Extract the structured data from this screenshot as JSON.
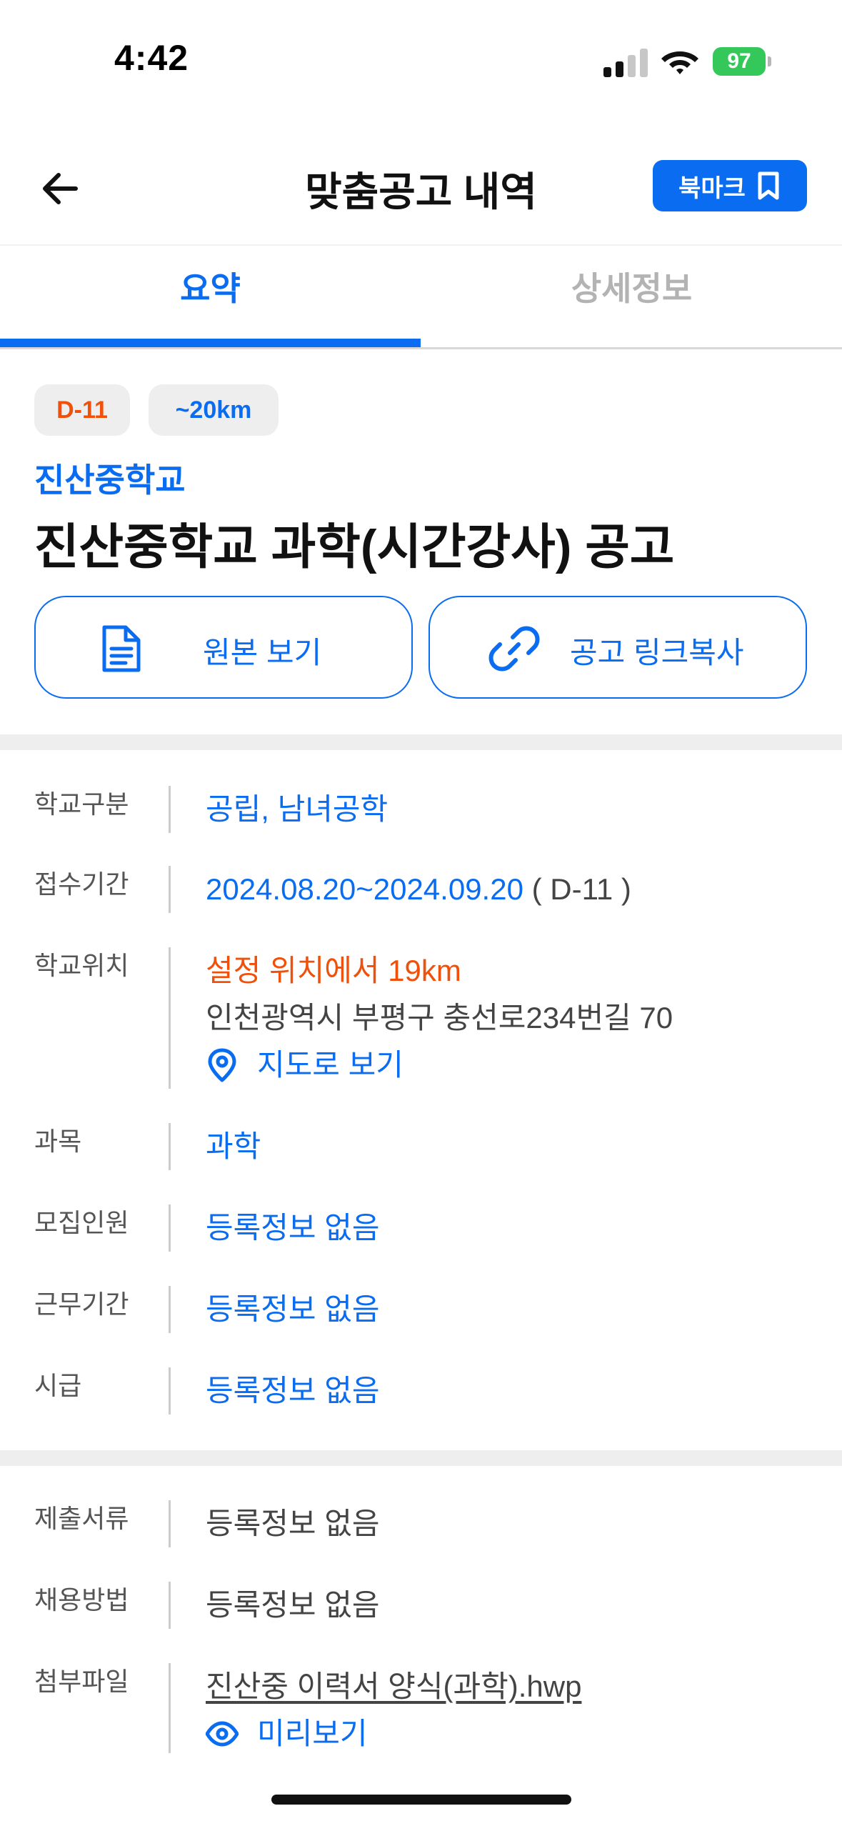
{
  "status_bar": {
    "time": "4:42",
    "battery": "97"
  },
  "header": {
    "title": "맞춤공고 내역",
    "bookmark_label": "북마크"
  },
  "tabs": [
    {
      "label": "요약",
      "active": true
    },
    {
      "label": "상세정보",
      "active": false
    }
  ],
  "badges": {
    "dday": "D-11",
    "distance": "~20km"
  },
  "school": {
    "name": "진산중학교",
    "title": "진산중학교 과학(시간강사) 공고"
  },
  "actions": {
    "view_original": "원본 보기",
    "copy_link": "공고 링크복사"
  },
  "info": {
    "school_type": {
      "label": "학교구분",
      "value": "공립, 남녀공학"
    },
    "period": {
      "label": "접수기간",
      "value": "2024.08.20~2024.09.20",
      "suffix": " ( D-11 )"
    },
    "location": {
      "label": "학교위치",
      "distance": "설정 위치에서 19km",
      "address": "인천광역시 부평구 충선로234번길 70",
      "map_link": "지도로 보기"
    },
    "subject": {
      "label": "과목",
      "value": "과학"
    },
    "recruits": {
      "label": "모집인원",
      "value": "등록정보 없음"
    },
    "work_period": {
      "label": "근무기간",
      "value": "등록정보 없음"
    },
    "wage": {
      "label": "시급",
      "value": "등록정보 없음"
    }
  },
  "info2": {
    "documents": {
      "label": "제출서류",
      "value": "등록정보 없음"
    },
    "hiring_method": {
      "label": "채용방법",
      "value": "등록정보 없음"
    },
    "attachment": {
      "label": "첨부파일",
      "file": "진산중 이력서 양식(과학).hwp",
      "preview": "미리보기"
    }
  },
  "colors": {
    "accent": "#0a6cf1",
    "warning": "#f0500a",
    "battery": "#34c759"
  },
  "icons": [
    "back-arrow-icon",
    "bookmark-icon",
    "document-icon",
    "link-icon",
    "location-pin-icon",
    "eye-icon",
    "signal-icon",
    "wifi-icon"
  ]
}
